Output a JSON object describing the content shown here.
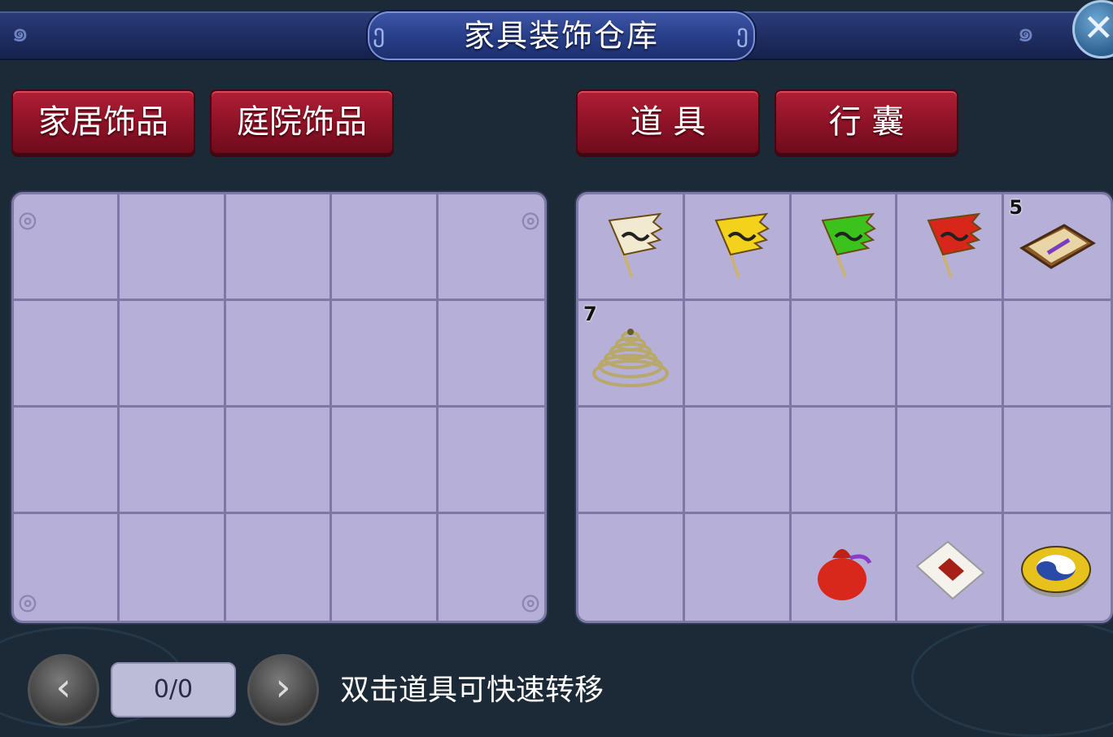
{
  "title": "家具装饰仓库",
  "tabs_left": [
    "家居饰品",
    "庭院饰品"
  ],
  "tabs_right": [
    "道 具",
    "行 囊"
  ],
  "right_grid": {
    "counts": {
      "4": "5",
      "5": "7"
    },
    "items": [
      {
        "slot": 0,
        "name": "white-flag-icon",
        "color": "#f2ead0"
      },
      {
        "slot": 1,
        "name": "yellow-flag-icon",
        "color": "#f2d21a"
      },
      {
        "slot": 2,
        "name": "green-flag-icon",
        "color": "#3cc21c"
      },
      {
        "slot": 3,
        "name": "red-flag-icon",
        "color": "#d8261a"
      },
      {
        "slot": 4,
        "name": "scroll-box-icon"
      },
      {
        "slot": 5,
        "name": "incense-coil-icon"
      },
      {
        "slot": 17,
        "name": "red-pouch-icon"
      },
      {
        "slot": 18,
        "name": "envelope-icon"
      },
      {
        "slot": 19,
        "name": "taiji-compass-icon"
      }
    ]
  },
  "pager": {
    "value": "0/0",
    "prev": "‹",
    "next": "›"
  },
  "hint": "双击道具可快速转移",
  "close_symbol": "✕"
}
